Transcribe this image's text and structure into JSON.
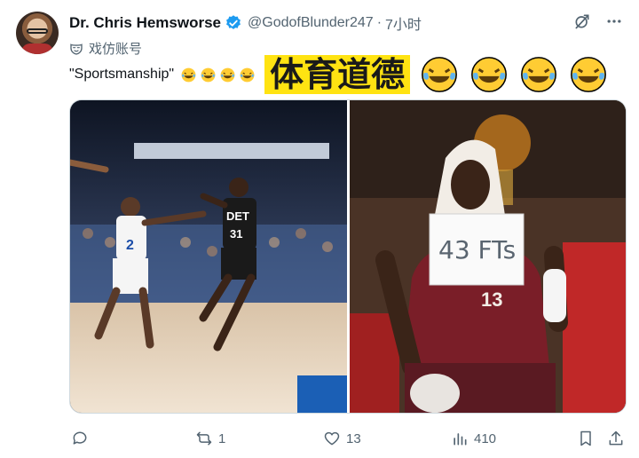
{
  "author": {
    "display_name": "Dr. Chris Hemsworse",
    "handle": "@GodofBlunder247",
    "separator": "·",
    "time": "7小时",
    "sub_label": "戏仿账号"
  },
  "tweet": {
    "quote_text": "\"Sportsmanship\"",
    "highlight_text": "体育道德"
  },
  "media": {
    "left_jersey_a": "2",
    "left_jersey_b": "31",
    "left_jersey_team": "DET",
    "right_sign_text": "43 FTs",
    "right_jersey": "13"
  },
  "actions": {
    "reply_count": "",
    "retweet_count": "1",
    "like_count": "13",
    "views_count": "410"
  },
  "icons": {
    "verified": "verified-badge-icon",
    "grok": "grok-icon",
    "more": "more-icon",
    "parody": "parody-mask-icon",
    "reply": "reply-icon",
    "retweet": "retweet-icon",
    "like": "like-icon",
    "views": "views-icon",
    "bookmark": "bookmark-icon",
    "share": "share-icon",
    "emoji": "tears-of-joy-emoji"
  },
  "colors": {
    "verified_blue": "#1d9bf0",
    "secondary_text": "#536471",
    "highlight_yellow": "#ffe312"
  }
}
